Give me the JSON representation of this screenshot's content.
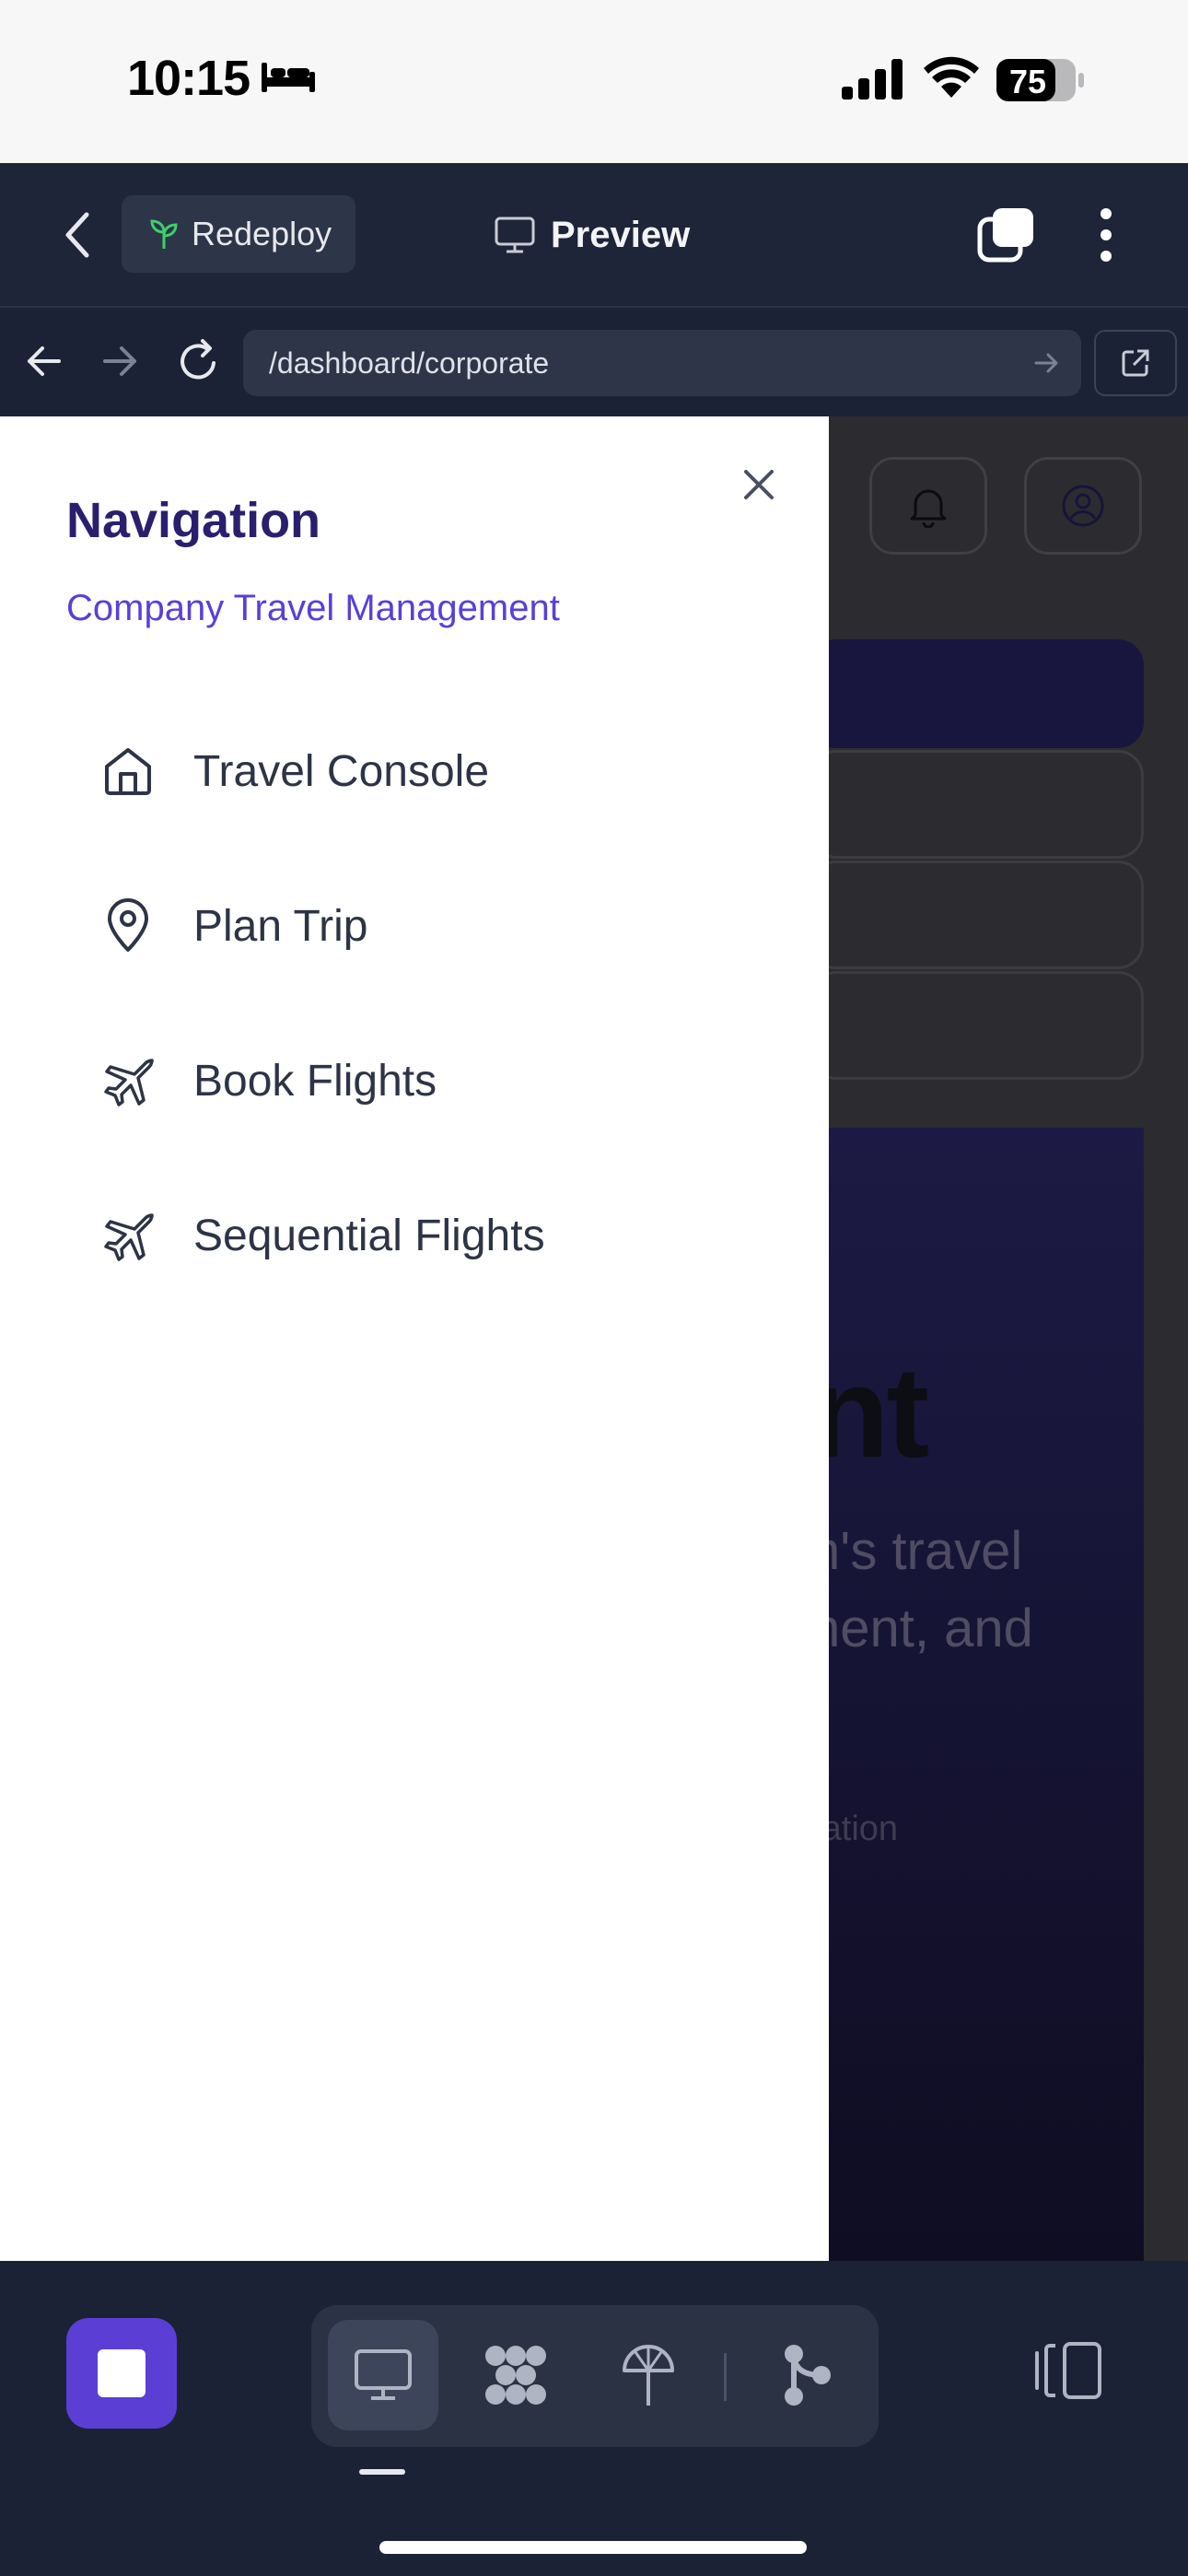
{
  "status_bar": {
    "time": "10:15",
    "battery": "75",
    "icons": [
      "bed-icon",
      "cellular-signal-icon",
      "wifi-icon",
      "battery-icon"
    ]
  },
  "toolbar": {
    "redeploy_label": "Redeploy",
    "preview_label": "Preview",
    "icons": [
      "chevron-left-icon",
      "sprout-icon",
      "monitor-icon",
      "tabs-icon",
      "more-vertical-icon"
    ]
  },
  "browser": {
    "url": "/dashboard/corporate",
    "icons": [
      "arrow-left-icon",
      "arrow-right-icon",
      "reload-icon",
      "arrow-go-icon",
      "external-link-icon"
    ]
  },
  "drawer": {
    "title": "Navigation",
    "subtitle": "Company Travel Management",
    "items": [
      {
        "label": "Travel Console",
        "icon": "home-icon"
      },
      {
        "label": "Plan Trip",
        "icon": "map-pin-icon"
      },
      {
        "label": "Book Flights",
        "icon": "plane-icon"
      },
      {
        "label": "Sequential Flights",
        "icon": "plane-icon"
      }
    ]
  },
  "background_page": {
    "hero_heading_fragment": "nt",
    "hero_text_line1": "n's travel",
    "hero_text_line2": "nent, and",
    "hero_small": "ration"
  },
  "dock": {
    "icons": [
      "stop-icon",
      "monitor-icon",
      "grid-blobs-icon",
      "sprout-icon",
      "branch-icon",
      "side-panel-icon"
    ]
  },
  "colors": {
    "accent": "#5b3fd4",
    "drawer_title": "#2a1f6e",
    "drawer_subtitle": "#5a3fd8",
    "dark_chrome": "#1b2235"
  }
}
